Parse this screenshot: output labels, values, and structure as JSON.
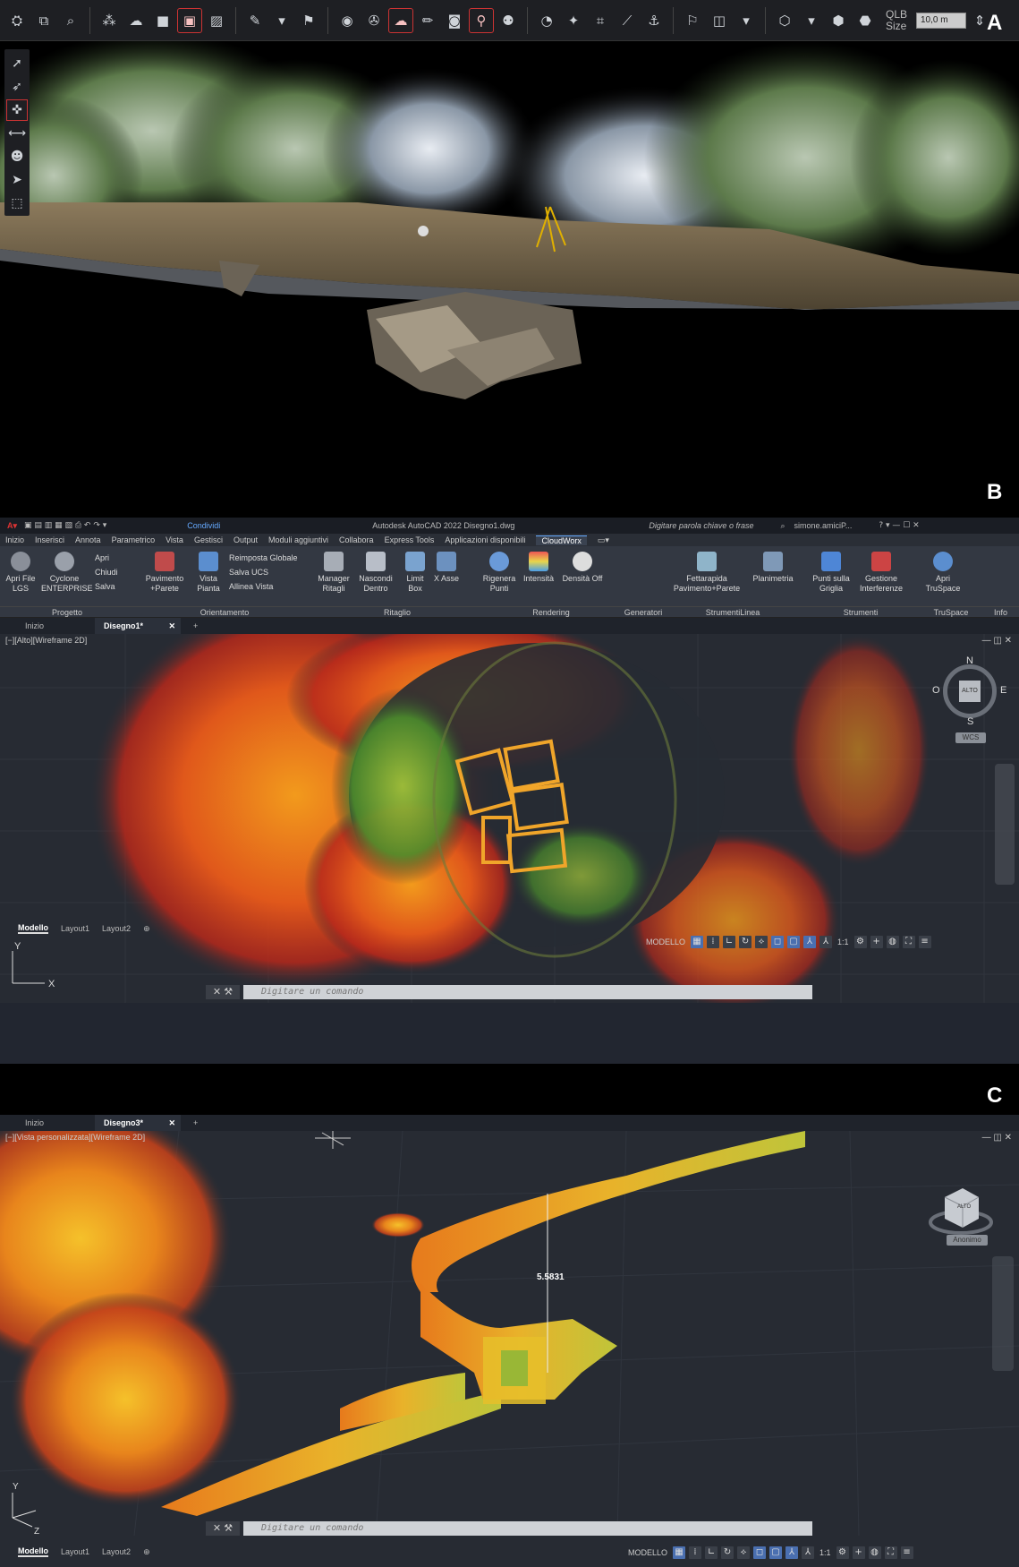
{
  "panels": {
    "a_label": "A",
    "b_label": "B",
    "c_label": "C"
  },
  "cyclone": {
    "qlb_label": "QLB Size",
    "qlb_value": "10,0 m"
  },
  "autocad": {
    "title": "Autodesk AutoCAD 2022   Disegno1.dwg",
    "share": "Condividi",
    "search_placeholder": "Digitare parola chiave o frase",
    "user": "simone.amiciP...",
    "menu": [
      "Inizio",
      "Inserisci",
      "Annota",
      "Parametrico",
      "Vista",
      "Gestisci",
      "Output",
      "Moduli aggiuntivi",
      "Collabora",
      "Express Tools",
      "Applicazioni disponibili",
      "CloudWorx"
    ],
    "ribbon": {
      "apri_file_lgs": "Apri File LGS",
      "cyclone_enterprise": "Cyclone ENTERPRISE",
      "apri": "Apri",
      "chiudi": "Chiudi",
      "salva": "Salva",
      "pavimento_parete": "Pavimento +Parete",
      "vista_pianta": "Vista Pianta",
      "reimposta_globale": "Reimposta Globale",
      "salva_ucs": "Salva UCS",
      "allinea_vista": "Allinea Vista",
      "manager_ritagli": "Manager Ritagli",
      "nascondi_dentro": "Nascondi Dentro",
      "limit_box": "Limit Box",
      "x_asse": "X Asse",
      "rigenera_punti": "Rigenera Punti",
      "intensita": "Intensità",
      "densita_off": "Densità Off",
      "fettarapida": "Fettarapida Pavimento+Parete",
      "planimetria": "Planimetria",
      "punti_griglia": "Punti sulla Griglia",
      "gestione_interferenze": "Gestione Interferenze",
      "apri_truspace": "Apri TruSpace",
      "groups": [
        "Progetto",
        "Orientamento",
        "Ritaglio",
        "Rendering",
        "Generatori",
        "StrumentiLinea",
        "Strumenti",
        "TruSpace",
        "Info"
      ]
    },
    "b_tabs": {
      "start": "Inizio",
      "doc": "Disegno1*"
    },
    "b_viewport_label": "[−][Alto][Wireframe 2D]",
    "viewcube": {
      "top": "ALTO",
      "n": "N",
      "s": "S",
      "e": "E",
      "w": "O",
      "wcs": "WCS"
    },
    "command_placeholder": "Digitare un comando",
    "layouts": [
      "Modello",
      "Layout1",
      "Layout2"
    ],
    "status_model": "MODELLO",
    "scale": "1:1",
    "c_tabs": {
      "start": "Inizio",
      "doc": "Disegno3*"
    },
    "c_viewport_label": "[−][Vista personalizzata][Wireframe 2D]",
    "c_viewcube_label": "Anonimo",
    "c_cube_top": "ALTO",
    "measure": "5.5831"
  },
  "colors": {
    "cad_bg": "#272b33",
    "ribbon_bg": "#333842",
    "accent": "#4a6fb0"
  }
}
